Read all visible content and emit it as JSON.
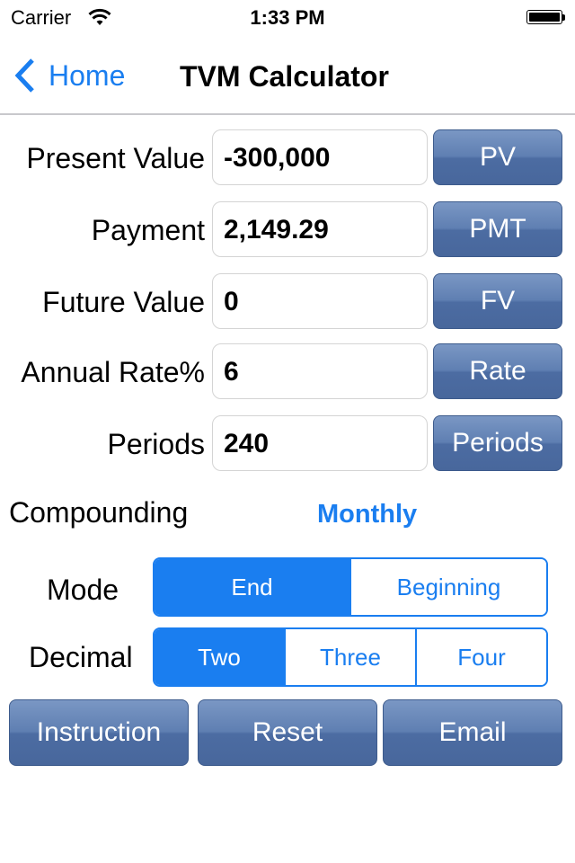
{
  "status_bar": {
    "carrier": "Carrier",
    "time": "1:33 PM",
    "battery_level": 1.0
  },
  "nav": {
    "back_label": "Home",
    "title": "TVM Calculator"
  },
  "fields": [
    {
      "label": "Present Value",
      "value": "-300,000",
      "button": "PV"
    },
    {
      "label": "Payment",
      "value": "2,149.29",
      "button": "PMT"
    },
    {
      "label": "Future Value",
      "value": "0",
      "button": "FV"
    },
    {
      "label": "Annual Rate%",
      "value": "6",
      "button": "Rate"
    },
    {
      "label": "Periods",
      "value": "240",
      "button": "Periods"
    }
  ],
  "compounding": {
    "label": "Compounding",
    "value": "Monthly"
  },
  "mode": {
    "label": "Mode",
    "options": [
      "End",
      "Beginning"
    ],
    "selected": "End"
  },
  "decimal": {
    "label": "Decimal",
    "options": [
      "Two",
      "Three",
      "Four"
    ],
    "selected": "Two"
  },
  "actions": {
    "instruction": "Instruction",
    "reset": "Reset",
    "email": "Email"
  },
  "colors": {
    "accent": "#1a7ef0",
    "button_blue": "#5f7fb2"
  }
}
